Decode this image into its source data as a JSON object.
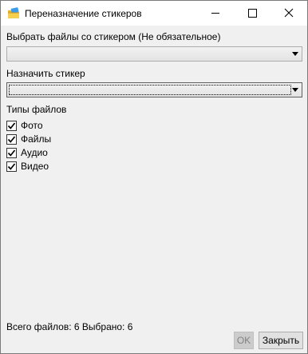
{
  "window": {
    "title": "Переназначение стикеров",
    "app_icon": "sticker-folder-icon",
    "controls": [
      "minimize-icon",
      "maximize-icon",
      "close-icon"
    ]
  },
  "source": {
    "label": "Выбрать файлы со стикером (Не обязательное)",
    "selected_value": ""
  },
  "target": {
    "label": "Назначить стикер",
    "selected_value": ""
  },
  "file_types": {
    "label": "Типы файлов",
    "items": [
      {
        "label": "Фото",
        "checked": true
      },
      {
        "label": "Файлы",
        "checked": true
      },
      {
        "label": "Аудио",
        "checked": true
      },
      {
        "label": "Видео",
        "checked": true
      }
    ]
  },
  "status": {
    "text": "Всего файлов: 6 Выбрано: 6"
  },
  "buttons": {
    "ok_label": "OK",
    "ok_enabled": false,
    "close_label": "Закрыть"
  },
  "colors": {
    "dialog_bg": "#f0f0f0",
    "titlebar_bg": "#ffffff",
    "disabled_text": "#838383"
  }
}
